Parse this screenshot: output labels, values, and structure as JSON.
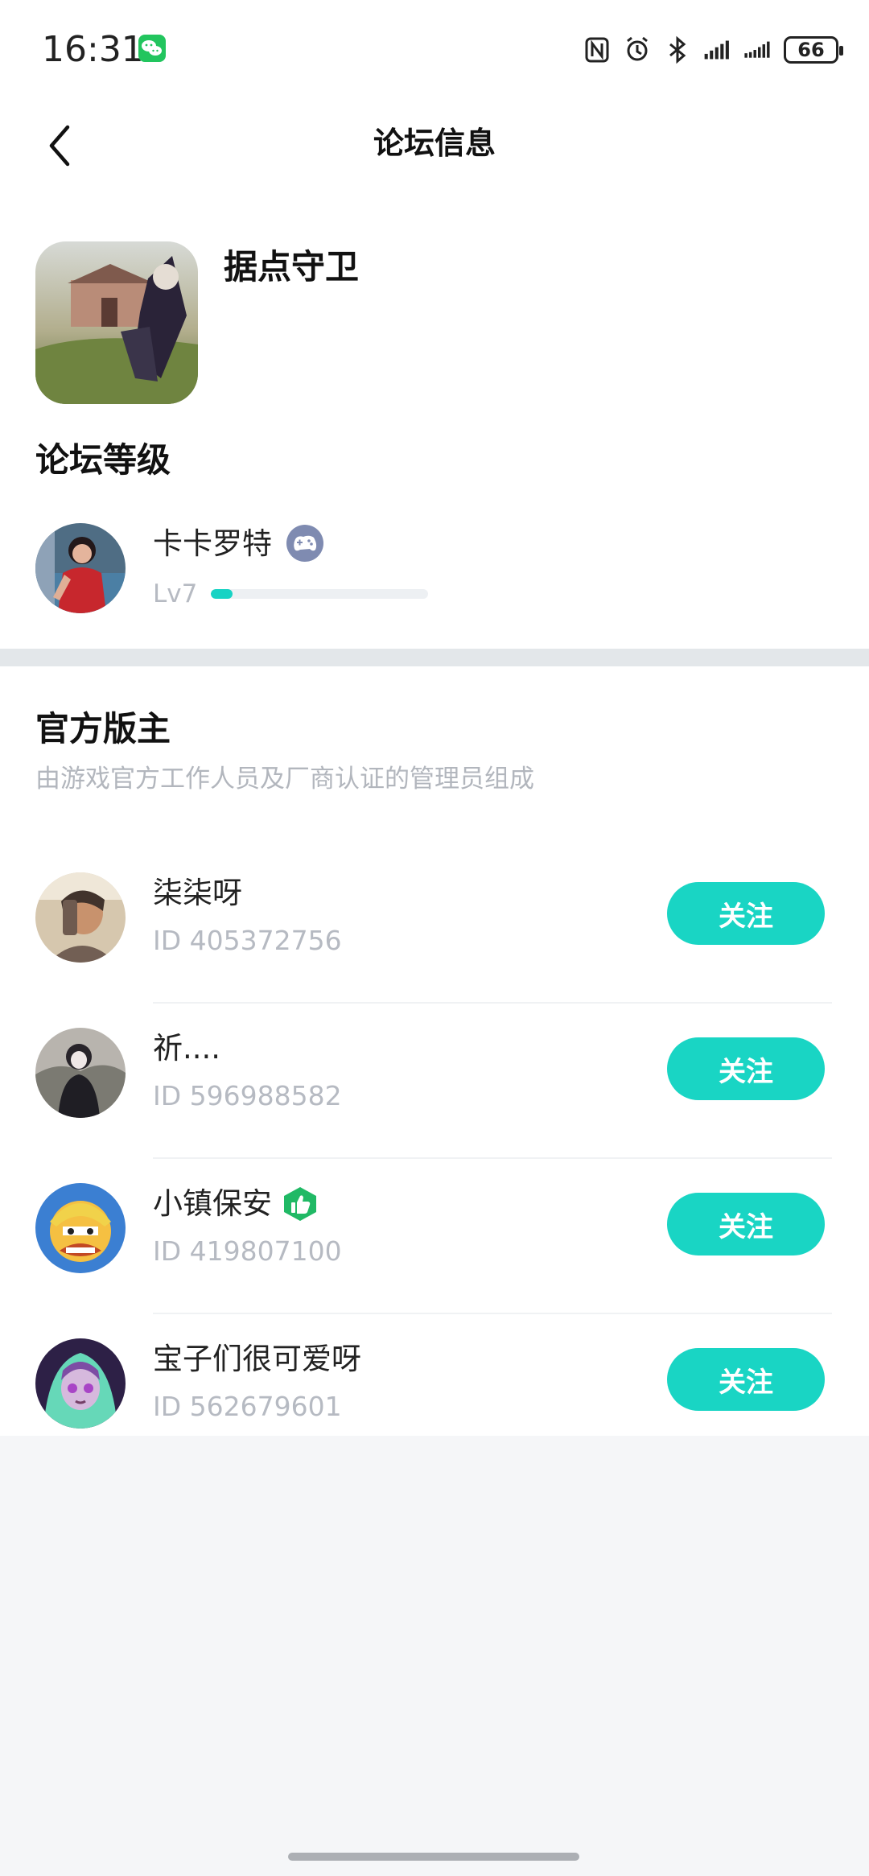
{
  "status_bar": {
    "time": "16:31",
    "battery": "66",
    "icons": [
      "wechat-icon",
      "nfc-icon",
      "alarm-icon",
      "bluetooth-icon",
      "signal-icon",
      "signal-icon",
      "battery-icon"
    ]
  },
  "header": {
    "title": "论坛信息",
    "back_icon": "back-icon"
  },
  "forum": {
    "name": "据点守卫",
    "level_heading": "论坛等级",
    "user": {
      "name": "卡卡罗特",
      "level": "Lv7",
      "progress": 0.1
    }
  },
  "moderators": {
    "heading": "官方版主",
    "subtitle": "由游戏官方工作人员及厂商认证的管理员组成",
    "items": [
      {
        "name": "柒柒呀",
        "id": "ID 405372756",
        "follow_label": "关注",
        "verified": false
      },
      {
        "name": "祈....",
        "id": "ID 596988582",
        "follow_label": "关注",
        "verified": false
      },
      {
        "name": "小镇保安",
        "id": "ID 419807100",
        "follow_label": "关注",
        "verified": true
      },
      {
        "name": "宝子们很可爱呀",
        "id": "ID 562679601",
        "follow_label": "关注",
        "verified": false
      }
    ]
  },
  "colors": {
    "accent": "#19d5c4",
    "background": "#f5f6f8",
    "card": "#ffffff",
    "muted_text": "#b6bac2"
  }
}
